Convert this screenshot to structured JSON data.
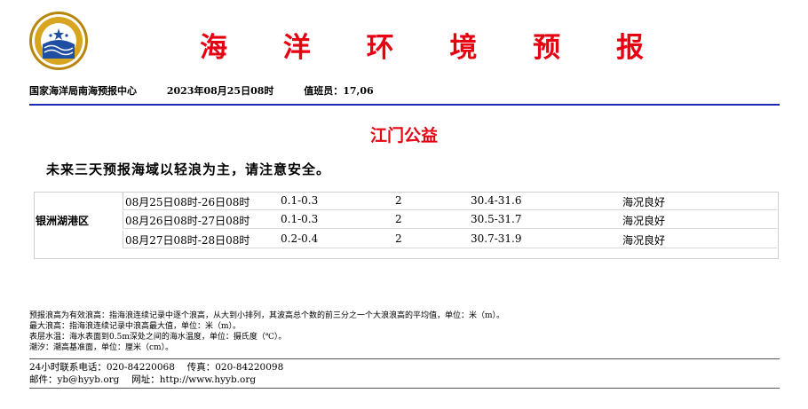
{
  "header": {
    "title": "海 洋 环 境 预 报",
    "org": "国家海洋局南海预报中心",
    "date": "2023年08月25日08时",
    "duty": "值班员：17,06"
  },
  "area": {
    "name": "江门公益"
  },
  "summary": "未来三天预报海域以轻浪为主，请注意安全。",
  "forecast": {
    "region": "银洲湖港区",
    "rows": [
      {
        "time": "08月25日08时-26日08时",
        "wave": "0.1-0.3",
        "level": "2",
        "temp": "30.4-31.6",
        "state": "海况良好"
      },
      {
        "time": "08月26日08时-27日08时",
        "wave": "0.1-0.3",
        "level": "2",
        "temp": "30.5-31.7",
        "state": "海况良好"
      },
      {
        "time": "08月27日08时-28日08时",
        "wave": "0.2-0.4",
        "level": "2",
        "temp": "30.7-31.9",
        "state": "海况良好"
      }
    ]
  },
  "notes": [
    "预报浪高为有效浪高：指海浪连续记录中逐个浪高，从大到小排列，其波高总个数的前三分之一个大浪浪高的平均值，单位：米（m）。",
    "最大浪高：指海浪连续记录中浪高最大值，单位：米（m）。",
    "表层水温：海水表面到0.5m深处之间的海水温度，单位：摄氏度（℃）。",
    "潮汐：潮高基准面，单位：厘米（cm）。"
  ],
  "contact": {
    "phone_line": "24小时联系电话：020-84220068　 传真：020-84220098",
    "email_line": "邮件：yb@hyyb.org　 网址：http://www.hyyb.org"
  },
  "logo_icon": "soa-emblem-icon",
  "colors": {
    "title": "#e60012",
    "rule": "#1a2bb8"
  }
}
